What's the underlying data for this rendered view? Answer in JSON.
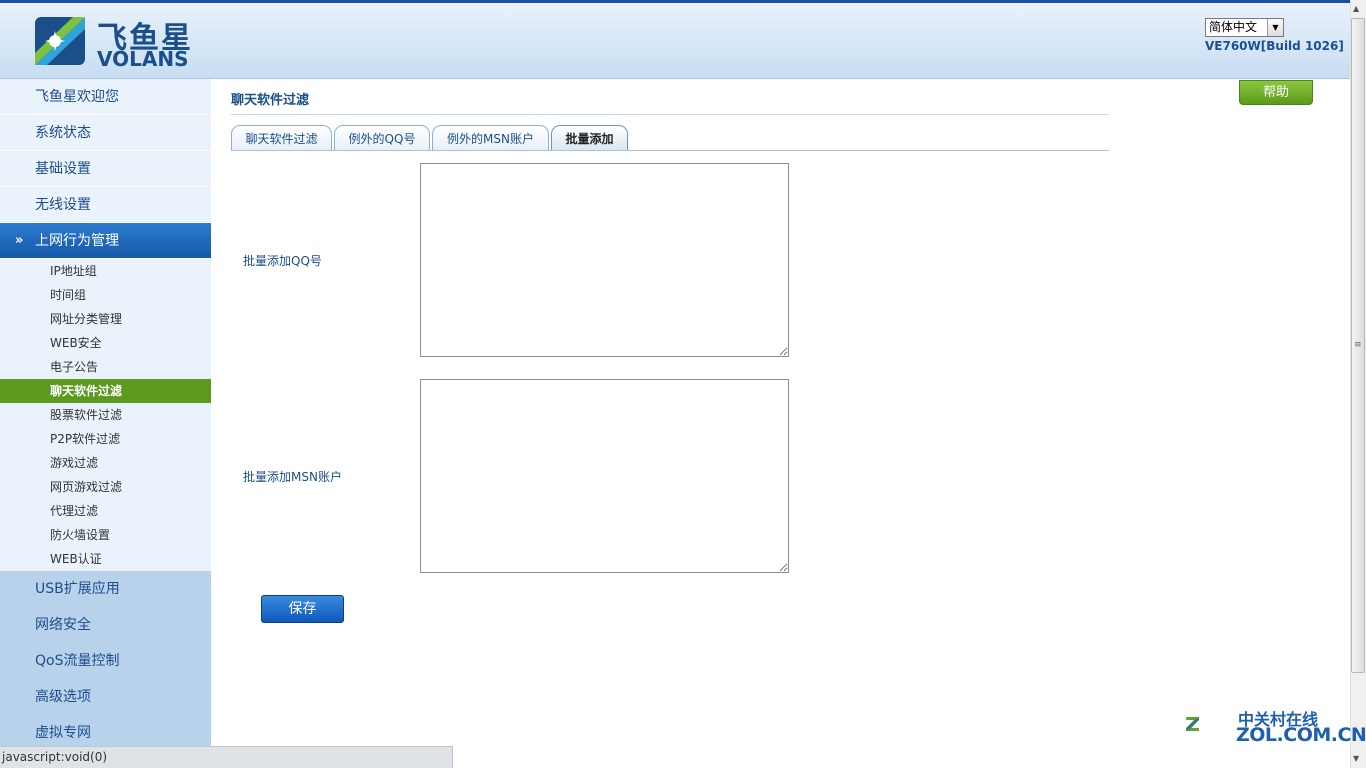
{
  "header": {
    "logo_cn": "飞鱼星",
    "logo_en": "VOLANS",
    "language": "简体中文",
    "build": "VE760W[Build 1026]"
  },
  "sidebar": {
    "top_items": [
      {
        "label": "飞鱼星欢迎您"
      },
      {
        "label": "系统状态"
      },
      {
        "label": "基础设置"
      },
      {
        "label": "无线设置"
      }
    ],
    "active_section": {
      "label": "上网行为管理"
    },
    "sub_items": [
      {
        "label": "IP地址组"
      },
      {
        "label": "时间组"
      },
      {
        "label": "网址分类管理"
      },
      {
        "label": "WEB安全"
      },
      {
        "label": "电子公告"
      },
      {
        "label": "聊天软件过滤"
      },
      {
        "label": "股票软件过滤"
      },
      {
        "label": "P2P软件过滤"
      },
      {
        "label": "游戏过滤"
      },
      {
        "label": "网页游戏过滤"
      },
      {
        "label": "代理过滤"
      },
      {
        "label": "防火墙设置"
      },
      {
        "label": "WEB认证"
      }
    ],
    "bottom_items": [
      {
        "label": "USB扩展应用"
      },
      {
        "label": "网络安全"
      },
      {
        "label": "QoS流量控制"
      },
      {
        "label": "高级选项"
      },
      {
        "label": "虚拟专网"
      }
    ]
  },
  "main": {
    "title": "聊天软件过滤",
    "help_label": "帮助",
    "tabs": [
      {
        "label": "聊天软件过滤"
      },
      {
        "label": "例外的QQ号"
      },
      {
        "label": "例外的MSN账户"
      },
      {
        "label": "批量添加"
      }
    ],
    "qq_label": "批量添加QQ号",
    "msn_label": "批量添加MSN账户",
    "qq_value": "",
    "msn_value": "",
    "save_label": "保存"
  },
  "statusbar": {
    "text": "javascript:void(0)"
  },
  "watermark": {
    "cn": "中关村在线",
    "en": "ZOL.COM.CN"
  },
  "colors": {
    "accent_blue": "#1458a8",
    "active_green": "#5c9a1f",
    "help_green": "#6aa82a"
  }
}
